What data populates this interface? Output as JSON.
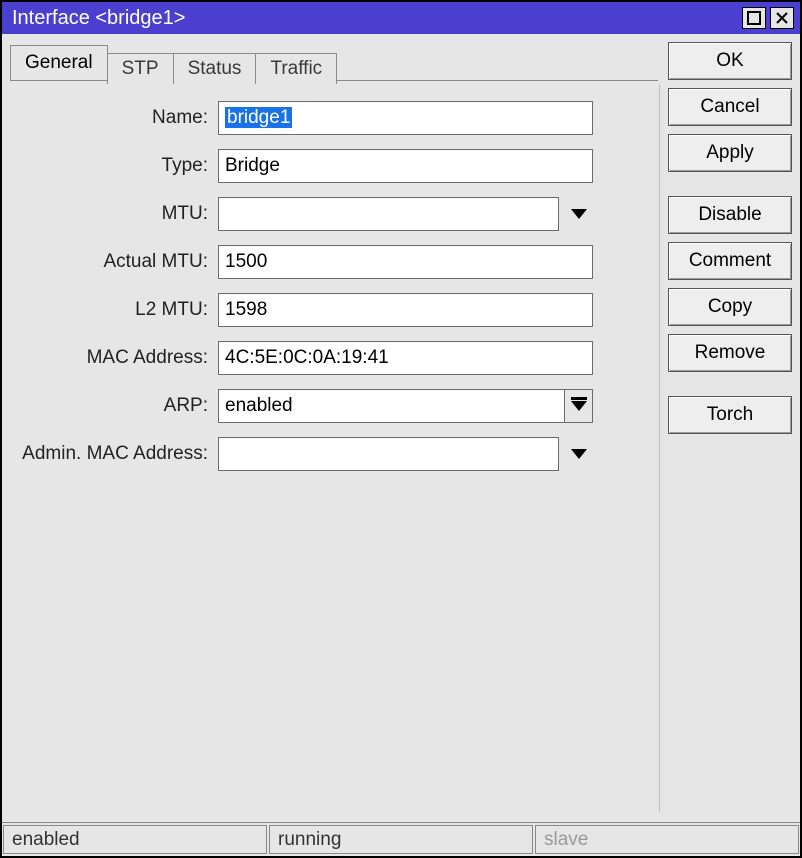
{
  "window": {
    "title": "Interface <bridge1>"
  },
  "tabs": {
    "general": "General",
    "stp": "STP",
    "status": "Status",
    "traffic": "Traffic",
    "active": "general"
  },
  "labels": {
    "name": "Name:",
    "type": "Type:",
    "mtu": "MTU:",
    "actual_mtu": "Actual MTU:",
    "l2_mtu": "L2 MTU:",
    "mac": "MAC Address:",
    "arp": "ARP:",
    "admin_mac": "Admin. MAC Address:"
  },
  "values": {
    "name": "bridge1",
    "type": "Bridge",
    "mtu": "",
    "actual_mtu": "1500",
    "l2_mtu": "1598",
    "mac": "4C:5E:0C:0A:19:41",
    "arp": "enabled",
    "admin_mac": ""
  },
  "buttons": {
    "ok": "OK",
    "cancel": "Cancel",
    "apply": "Apply",
    "disable": "Disable",
    "comment": "Comment",
    "copy": "Copy",
    "remove": "Remove",
    "torch": "Torch"
  },
  "status": {
    "enabled": "enabled",
    "running": "running",
    "slave": "slave"
  }
}
